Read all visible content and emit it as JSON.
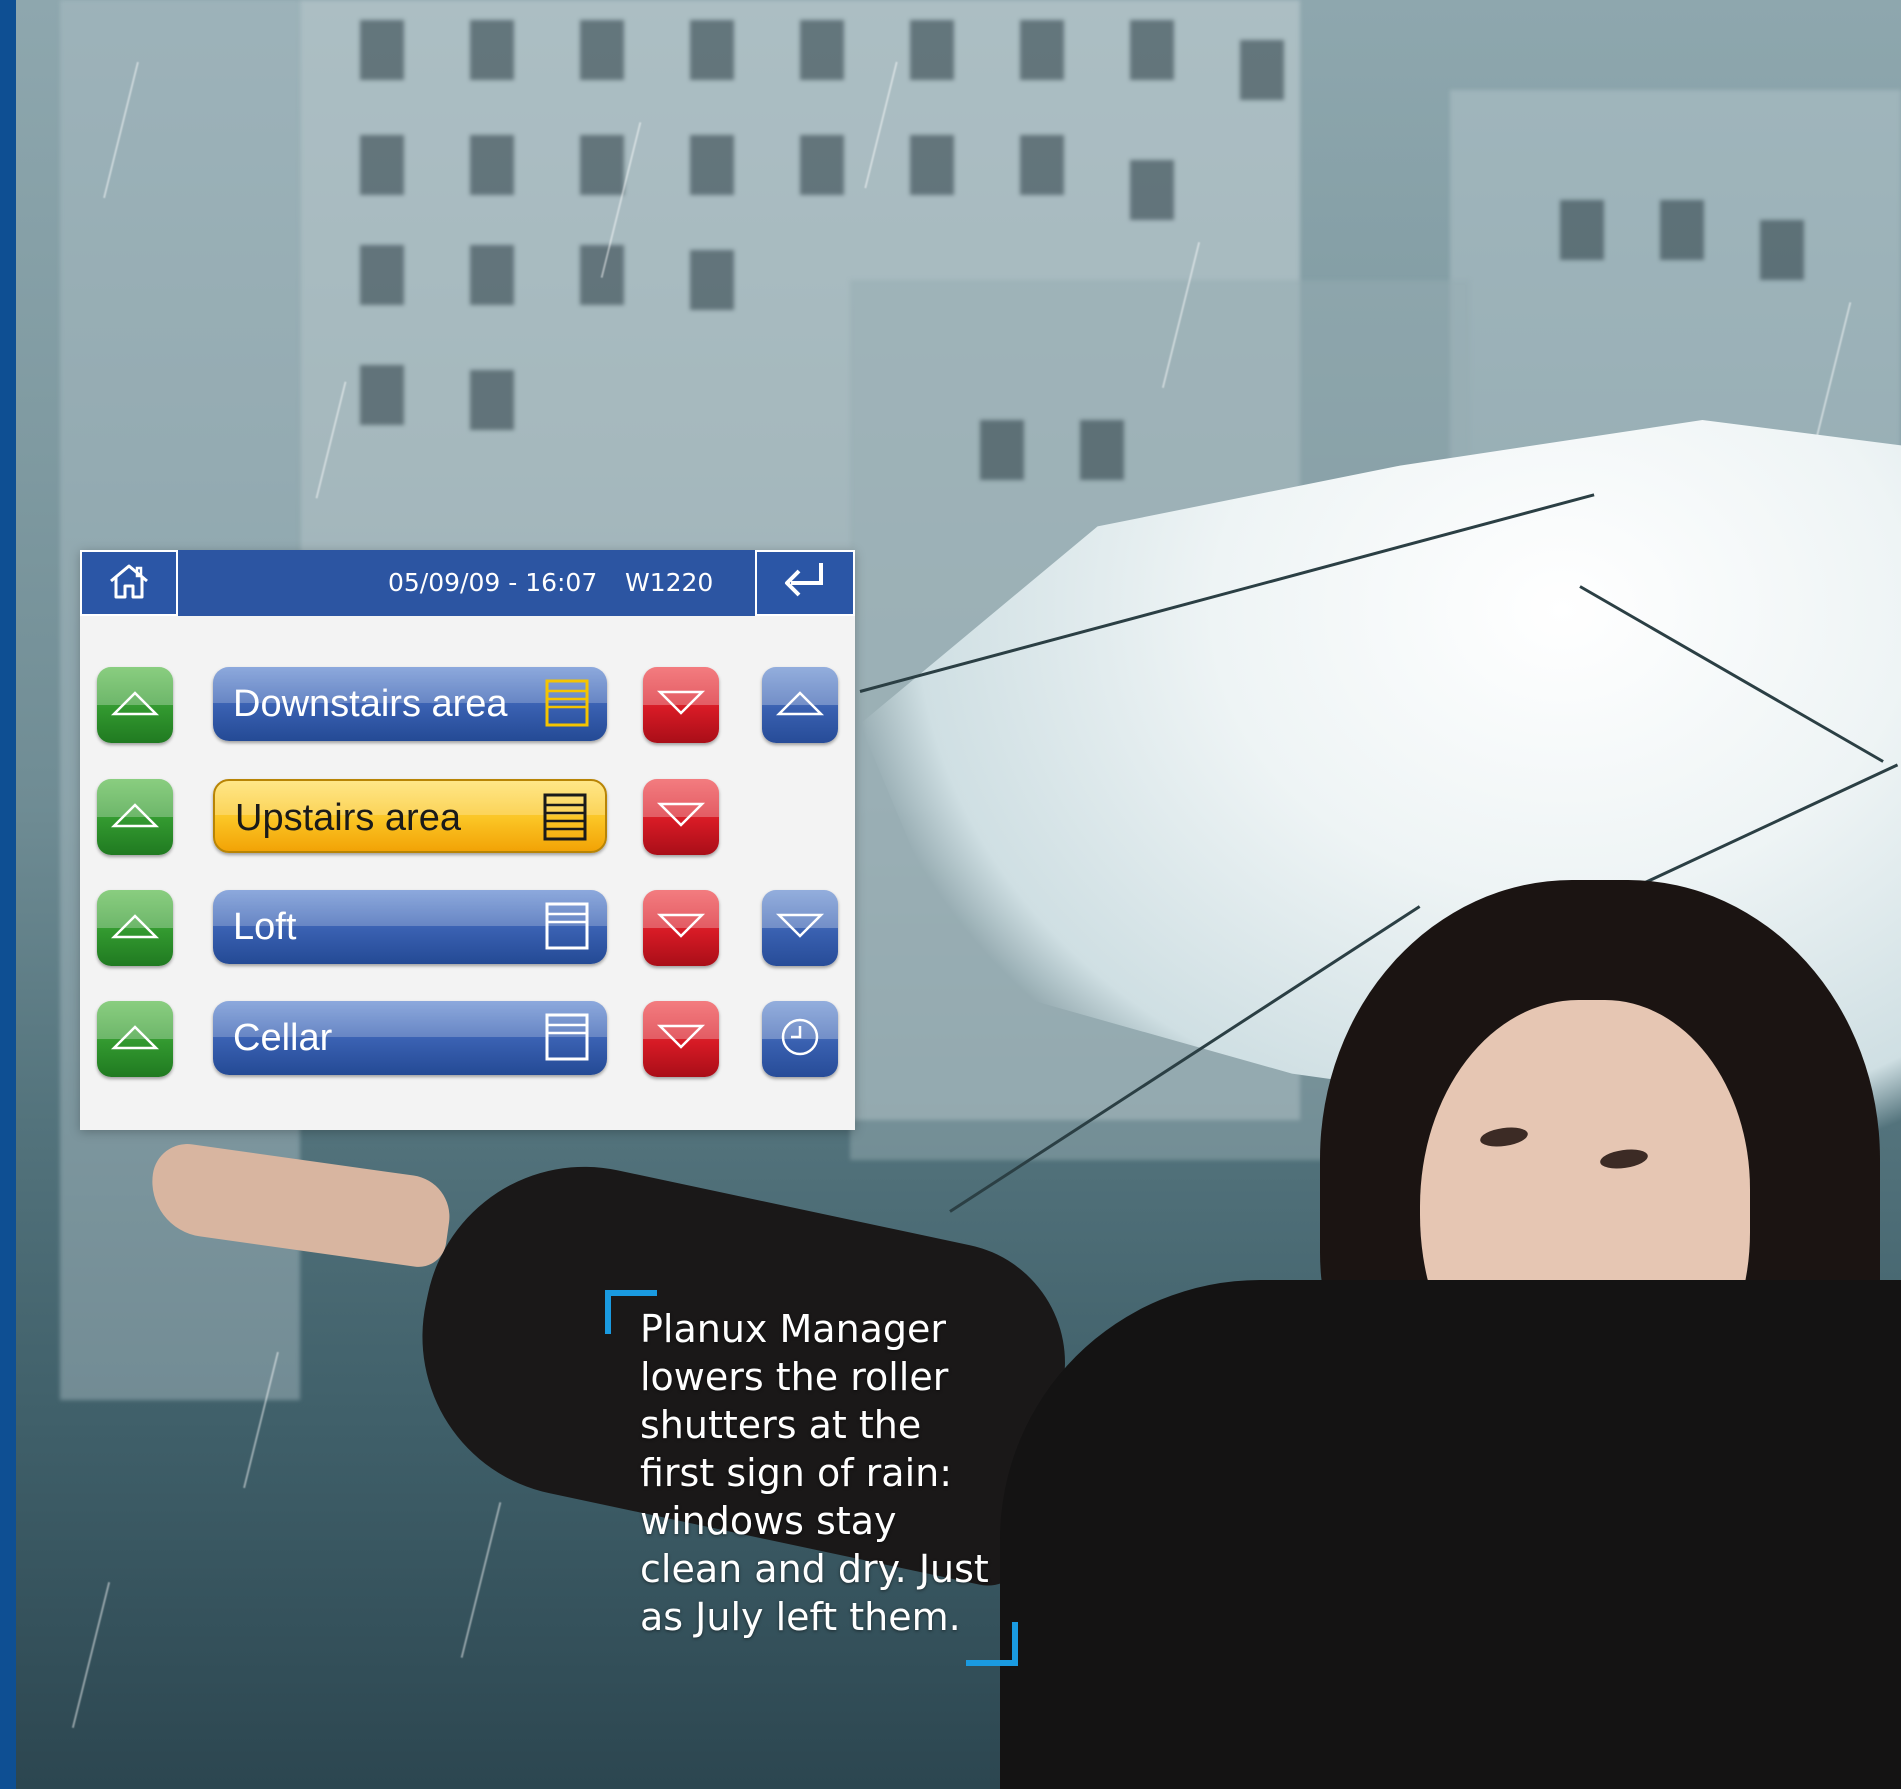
{
  "panel": {
    "header": {
      "home_icon": "home-icon",
      "datetime": "05/09/09 - 16:07",
      "code": "W1220",
      "back_icon": "return-arrow-icon"
    },
    "rows": [
      {
        "label": "Downstairs area",
        "state": "normal",
        "up": "up-arrow-icon",
        "down": "down-arrow-icon",
        "extra": "blue-up-arrow-icon"
      },
      {
        "label": "Upstairs area",
        "state": "selected",
        "up": "up-arrow-icon",
        "down": "down-arrow-icon",
        "extra": null
      },
      {
        "label": "Loft",
        "state": "normal",
        "up": "up-arrow-icon",
        "down": "down-arrow-icon",
        "extra": "blue-down-arrow-icon"
      },
      {
        "label": "Cellar",
        "state": "normal",
        "up": "up-arrow-icon",
        "down": "down-arrow-icon",
        "extra": "clock-icon"
      }
    ]
  },
  "caption": {
    "lines": [
      "Planux Manager",
      "lowers the roller",
      "shutters at the",
      "first sign of rain:",
      "windows stay",
      "clean and dry. Just",
      "as July left them."
    ]
  },
  "colors": {
    "header_blue": "#2c55a2",
    "green": "#32982f",
    "red": "#d61a25",
    "blue": "#3a61b2",
    "yellow": "#fbc626",
    "bracket": "#1a9ae0",
    "left_strip": "#0e4f93"
  }
}
